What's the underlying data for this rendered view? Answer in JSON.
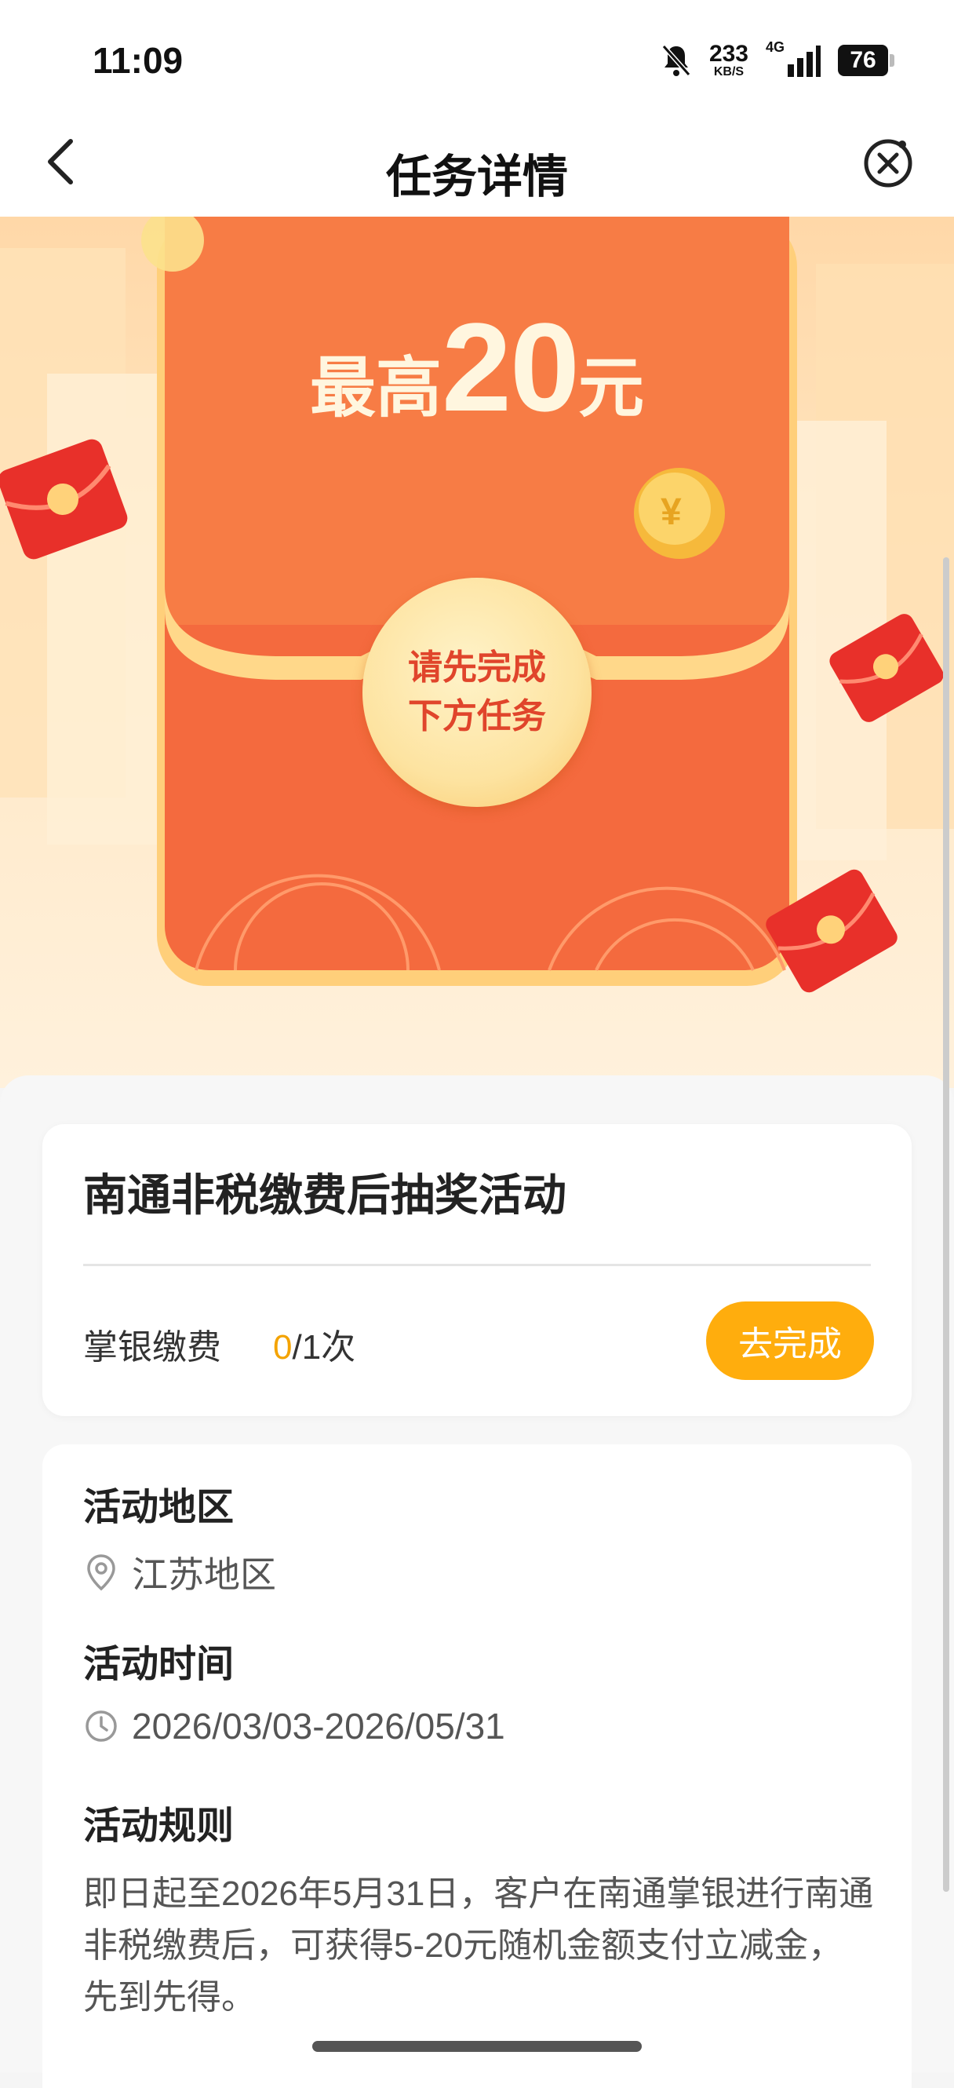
{
  "status_bar": {
    "time": "11:09",
    "net_speed": "233",
    "net_unit": "KB/S",
    "network": "4G",
    "battery": "76"
  },
  "nav": {
    "title": "任务详情"
  },
  "banner": {
    "prefix": "最高",
    "amount": "20",
    "suffix": "元",
    "seal_line1": "请先完成",
    "seal_line2": "下方任务"
  },
  "task": {
    "title": "南通非税缴费后抽奖活动",
    "name": "掌银缴费",
    "done": "0",
    "total": "/1次",
    "button": "去完成"
  },
  "info": {
    "region_head": "活动地区",
    "region_value": "江苏地区",
    "time_head": "活动时间",
    "time_value": "2026/03/03-2026/05/31",
    "rules_head": "活动规则",
    "rules_text": "即日起至2026年5月31日，客户在南通掌银进行南通非税缴费后，可获得5-20元随机金额支付立减金，先到先得。"
  },
  "colors": {
    "accent": "#ffad0d",
    "envelope": "#f0603a",
    "progress_done": "#f4a300"
  }
}
